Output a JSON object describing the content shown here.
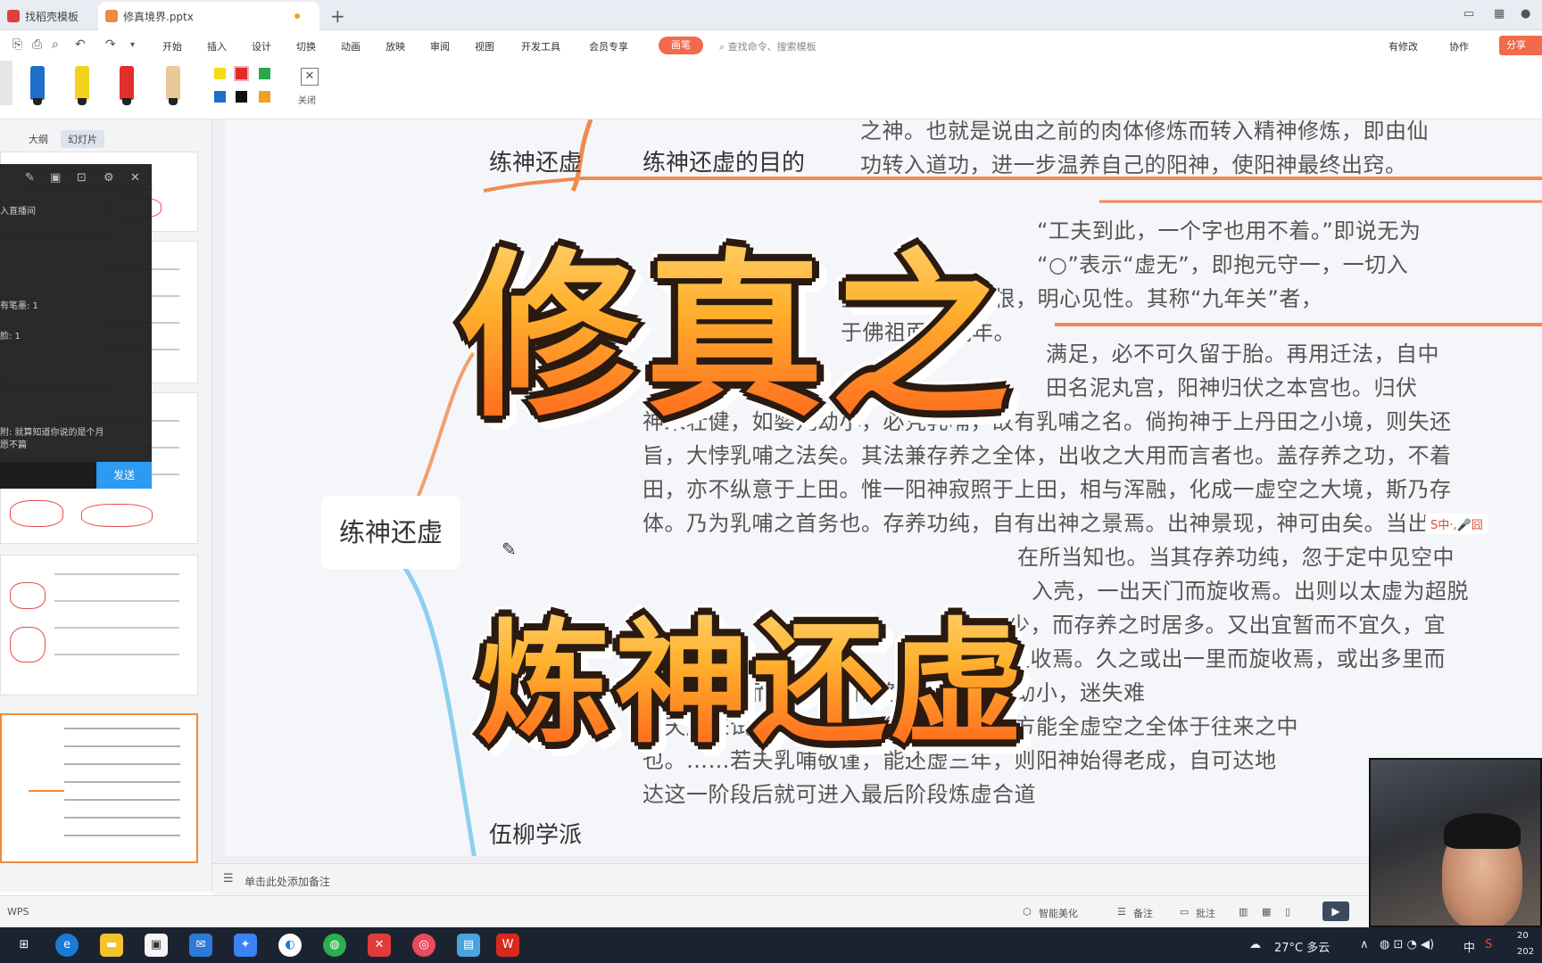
{
  "tabs": [
    {
      "label": "找稻壳模板",
      "icon_color": "#e0403a"
    },
    {
      "label": "修真境界.pptx",
      "icon_color": "#f08a3c"
    }
  ],
  "menu": [
    "开始",
    "插入",
    "设计",
    "切换",
    "动画",
    "放映",
    "审阅",
    "视图",
    "开发工具",
    "会员专享"
  ],
  "pen_badge": "画笔",
  "search_placeholder": "查找命令、搜索模板",
  "right_menu": {
    "modified": "有修改",
    "collab": "协作",
    "share": "分享"
  },
  "pen_tool": {
    "pens": [
      {
        "name": "pen-blue",
        "color": "#1d6fc9"
      },
      {
        "name": "pen-yellow",
        "color": "#f3d21e"
      },
      {
        "name": "pen-red",
        "color": "#e0302c"
      },
      {
        "name": "pen-tan",
        "color": "#e8c99a"
      }
    ],
    "swatches": [
      "#f5dc19",
      "#e02b2b",
      "#2aa74a",
      "#1d6fc9",
      "#111111",
      "#f0a020"
    ],
    "close_label": "关闭"
  },
  "left_panel": {
    "tab_outline": "大纲",
    "tab_slides": "幻灯片",
    "add_slide": "+"
  },
  "chat": {
    "line1": "入直播间",
    "line2": "有笔墨: 1",
    "line3": "脸: 1",
    "line4": "附: 就算知道你说的是个月",
    "line5": "愿不篇",
    "send": "发送"
  },
  "mindmap": {
    "root": "练神还虚",
    "branch1": "练神还虚",
    "branch1_child": "练神还虚的目的",
    "branch_bottom": "伍柳学派",
    "lines_top": [
      "之神。也就是说由之前的肉体修炼而转入精神修炼，即由仙",
      "功转入道功，进一步温养自己的阳神，使阳神最终出窍。"
    ],
    "lines_mid": [
      "“工夫到此，一个字也用不着。”即说无为",
      "“○”表示“虚无”，即抱元守一，一切入",
      "空之中，返本归根，明心见性。其称“九年关”者，",
      "于佛祖面壁九年。"
    ],
    "lines_body": [
      "满足，必不可久留于胎。再用迁法，自中",
      "田名泥丸宫，阳神归伏之本宫也。归伏",
      "神未壮健，如婴儿幼小，必凭乳哺，故有乳哺之名。倘拘神于上丹田之小境，则失还",
      "旨，大悖乳哺之法矣。其法兼存养之全体，出收之大用而言者也。盖存养之功，不着",
      "田，亦不纵意于上田。惟一阳神寂照于上田，相与浑融，化成一虚空之大境，斯乃存",
      "体。乃为乳哺之首务也。存养功纯，自有出神之景焉。出神景现，神可由矣。当出而",
      "在所当知也。当其存养功纯，忽于定中见空中",
      "入壳，一出天门而旋收焉。出则以太虚为超脱",
      "少，而存养之时居多。又出宜暂而不宜久，宜",
      "旋收焉。久之或出一里而旋收焉，或出多里而",
      "焉。一蹴等而至也。所以然者，以婴儿幼小，迷失难",
      "有天魔来试乱我心君，故须出入谨慎，方能全虚空之全体于往来之中",
      "也。……若夫乳哺敬谨，能还虚三年，则阳神始得老成，自可达地",
      "达这一阶段后就可进入最后阶段炼虚合道"
    ]
  },
  "overlay_titles": {
    "line1": "修真之",
    "line2": "炼神还虚"
  },
  "ime": "S中·,🎤囧",
  "notes_placeholder": "单击此处添加备注",
  "status": {
    "app": "WPS",
    "beautify": "智能美化",
    "notes": "备注",
    "comments": "批注"
  },
  "taskbar": {
    "weather": "27°C 多云",
    "ime": "中",
    "time": "20",
    "date": "202"
  }
}
